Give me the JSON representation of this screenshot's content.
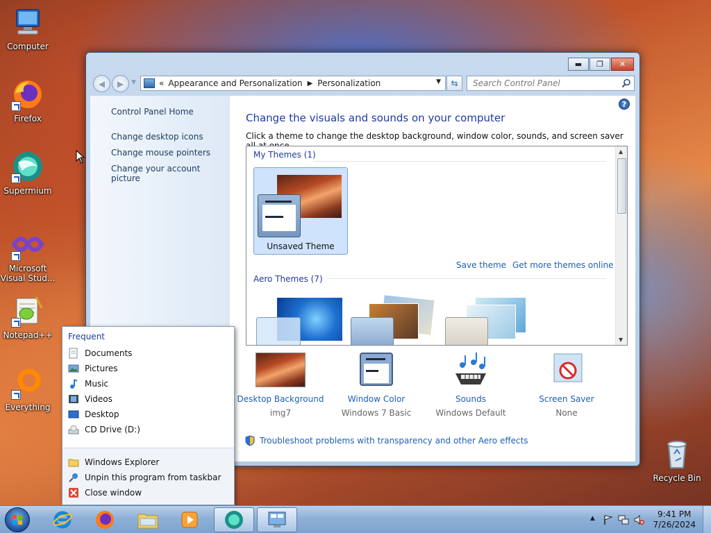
{
  "desktop": {
    "icons": [
      {
        "label": "Computer",
        "icon": "computer-icon"
      },
      {
        "label": "Firefox",
        "icon": "firefox-icon"
      },
      {
        "label": "Supermium",
        "icon": "supermium-icon"
      },
      {
        "label": "Microsoft Visual Stud...",
        "icon": "visual-studio-icon"
      },
      {
        "label": "Notepad++",
        "icon": "notepadpp-icon"
      },
      {
        "label": "Everything",
        "icon": "everything-icon"
      }
    ],
    "recycle_bin": {
      "label": "Recycle Bin",
      "icon": "recycle-bin-icon"
    }
  },
  "window": {
    "breadcrumb": {
      "overflow": "«",
      "parts": [
        "Appearance and Personalization",
        "Personalization"
      ]
    },
    "search_placeholder": "Search Control Panel",
    "controls": {
      "minimize": "▬",
      "maximize": "❐",
      "close": "✕"
    },
    "sidebar": {
      "home": "Control Panel Home",
      "links": [
        "Change desktop icons",
        "Change mouse pointers",
        "Change your account picture"
      ]
    },
    "main": {
      "title": "Change the visuals and sounds on your computer",
      "description": "Click a theme to change the desktop background, window color, sounds, and screen saver all at once.",
      "help": "?",
      "my_themes_header": "My Themes (1)",
      "unsaved_theme": "Unsaved Theme",
      "save_theme": "Save theme",
      "get_more": "Get more themes online",
      "aero_header": "Aero Themes (7)"
    },
    "bottom": [
      {
        "label": "Desktop Background",
        "sub": "img7",
        "icon": "desktop-background-icon"
      },
      {
        "label": "Window Color",
        "sub": "Windows 7 Basic",
        "icon": "window-color-icon"
      },
      {
        "label": "Sounds",
        "sub": "Windows Default",
        "icon": "sounds-icon"
      },
      {
        "label": "Screen Saver",
        "sub": "None",
        "icon": "screen-saver-icon"
      }
    ],
    "troubleshoot": "Troubleshoot problems with transparency and other Aero effects"
  },
  "jumplist": {
    "header": "Frequent",
    "frequent": [
      "Documents",
      "Pictures",
      "Music",
      "Videos",
      "Desktop",
      "CD Drive (D:)"
    ],
    "tasks": [
      "Windows Explorer",
      "Unpin this program from taskbar",
      "Close window"
    ]
  },
  "taskbar": {
    "time": "9:41 PM",
    "date": "7/26/2024",
    "tray_arrow": "▲"
  },
  "colors": {
    "link": "#1e5fb6",
    "heading": "#1e3b9e",
    "taskbar": "#8eb0d8"
  }
}
